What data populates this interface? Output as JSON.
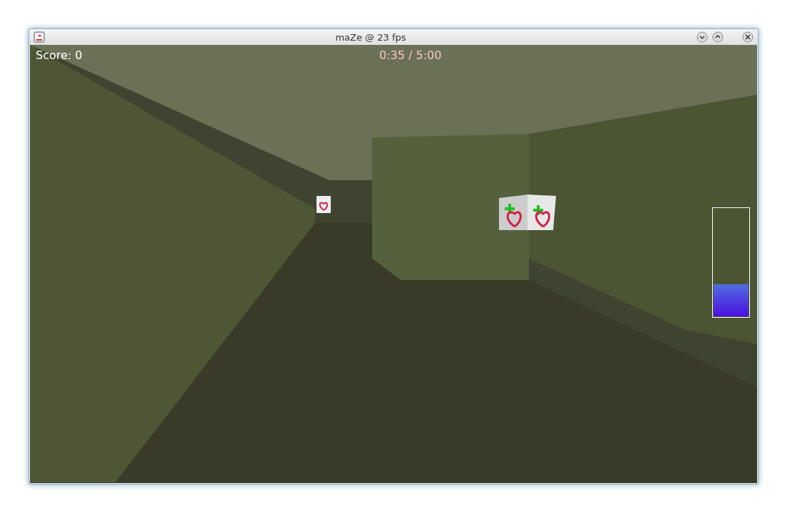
{
  "window": {
    "title": "maZe @ 23 fps"
  },
  "hud": {
    "score": "Score: 0",
    "timer": "0:35 / 5:00",
    "energy": {
      "level": 0.3
    }
  }
}
